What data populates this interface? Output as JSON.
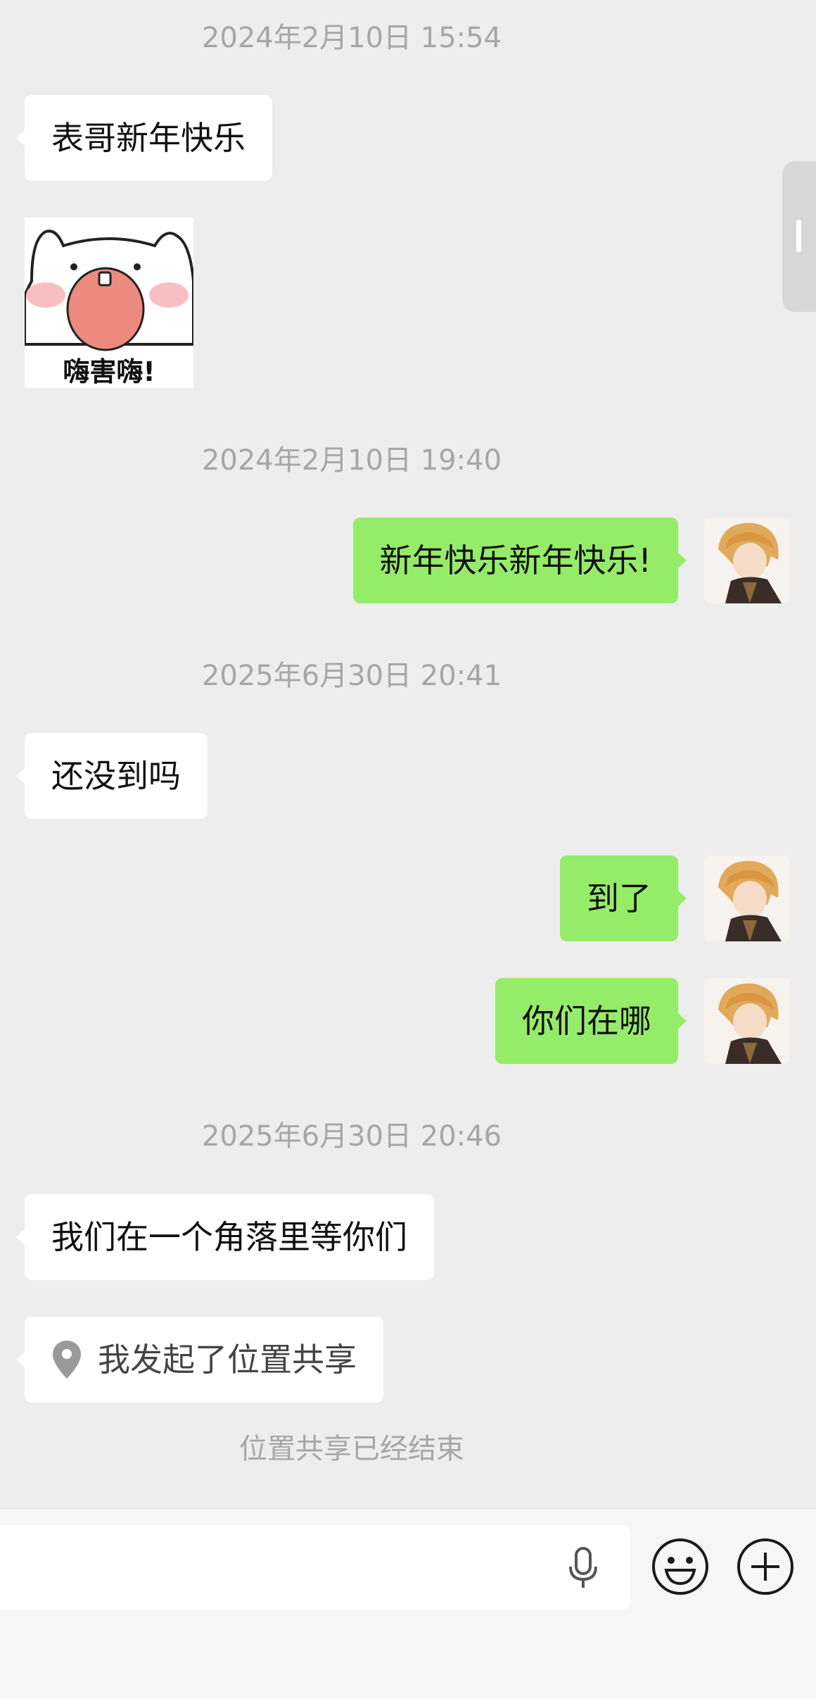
{
  "messages": {
    "ts1": "2024年2月10日 15:54",
    "m1": "表哥新年快乐",
    "sticker_text": "嗨害嗨!",
    "ts2": "2024年2月10日 19:40",
    "m2": "新年快乐新年快乐!",
    "ts3": "2025年6月30日 20:41",
    "m3": "还没到吗",
    "m4": "到了",
    "m5": "你们在哪",
    "ts4": "2025年6月30日 20:46",
    "m6": "我们在一个角落里等你们",
    "m7": "我发起了位置共享",
    "system_note": "位置共享已经结束"
  },
  "icons": {
    "location": "location-pin-icon",
    "mic": "microphone-icon",
    "emoji": "emoji-icon",
    "plus": "plus-icon"
  },
  "colors": {
    "background": "#ededed",
    "outgoing_bubble": "#95ec69",
    "incoming_bubble": "#ffffff",
    "timestamp": "#a6a6a6"
  }
}
